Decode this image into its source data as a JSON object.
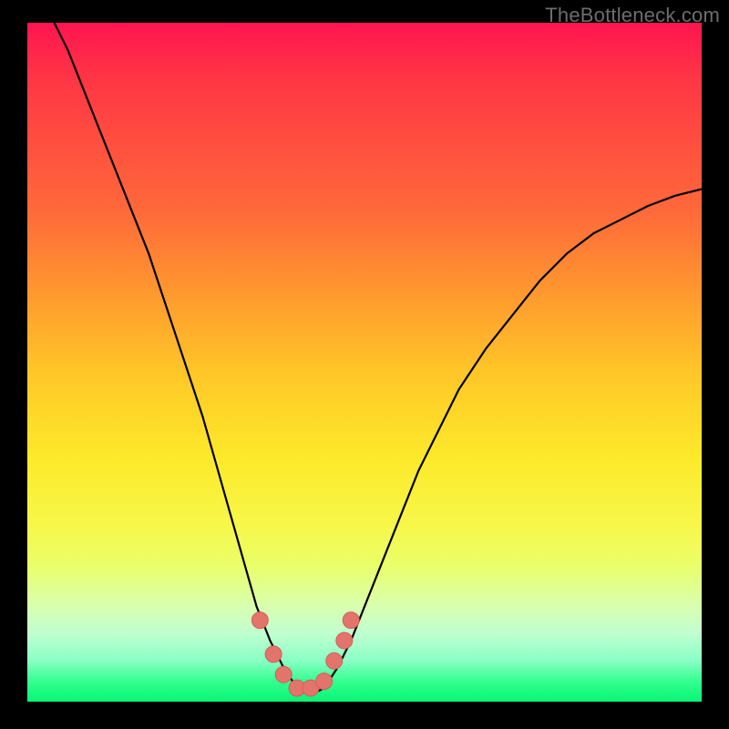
{
  "watermark": "TheBottleneck.com",
  "colors": {
    "page_bg": "#000000",
    "watermark": "#6d6d6d",
    "curve": "#000000",
    "markers": "#e2746c",
    "marker_stroke": "#d55e57"
  },
  "chart_data": {
    "type": "line",
    "title": "",
    "xlabel": "",
    "ylabel": "",
    "xlim": [
      0,
      100
    ],
    "ylim": [
      0,
      100
    ],
    "legend": false,
    "grid": false,
    "series": [
      {
        "name": "bottleneck-curve",
        "color": "#000000",
        "x": [
          4,
          6,
          8,
          10,
          12,
          14,
          16,
          18,
          20,
          22,
          24,
          26,
          28,
          30,
          32,
          34,
          36,
          38,
          40,
          42,
          44,
          46,
          48,
          50,
          52,
          54,
          56,
          58,
          60,
          64,
          68,
          72,
          76,
          80,
          84,
          88,
          92,
          96,
          100
        ],
        "values": [
          100,
          96,
          91,
          86,
          81,
          76,
          71,
          66,
          60,
          54,
          48,
          42,
          35,
          28,
          21,
          14,
          9,
          5,
          2,
          1,
          2,
          5,
          9,
          14,
          19,
          24,
          29,
          34,
          38,
          46,
          52,
          57,
          62,
          66,
          69,
          71,
          73,
          74.5,
          75.5
        ]
      }
    ],
    "markers": {
      "name": "highlight-points",
      "color": "#e2746c",
      "points": [
        {
          "x": 34.5,
          "y": 12
        },
        {
          "x": 36.5,
          "y": 7
        },
        {
          "x": 38,
          "y": 4
        },
        {
          "x": 40,
          "y": 2
        },
        {
          "x": 42,
          "y": 2
        },
        {
          "x": 44,
          "y": 3
        },
        {
          "x": 45.5,
          "y": 6
        },
        {
          "x": 47,
          "y": 9
        },
        {
          "x": 48,
          "y": 12
        }
      ]
    }
  }
}
